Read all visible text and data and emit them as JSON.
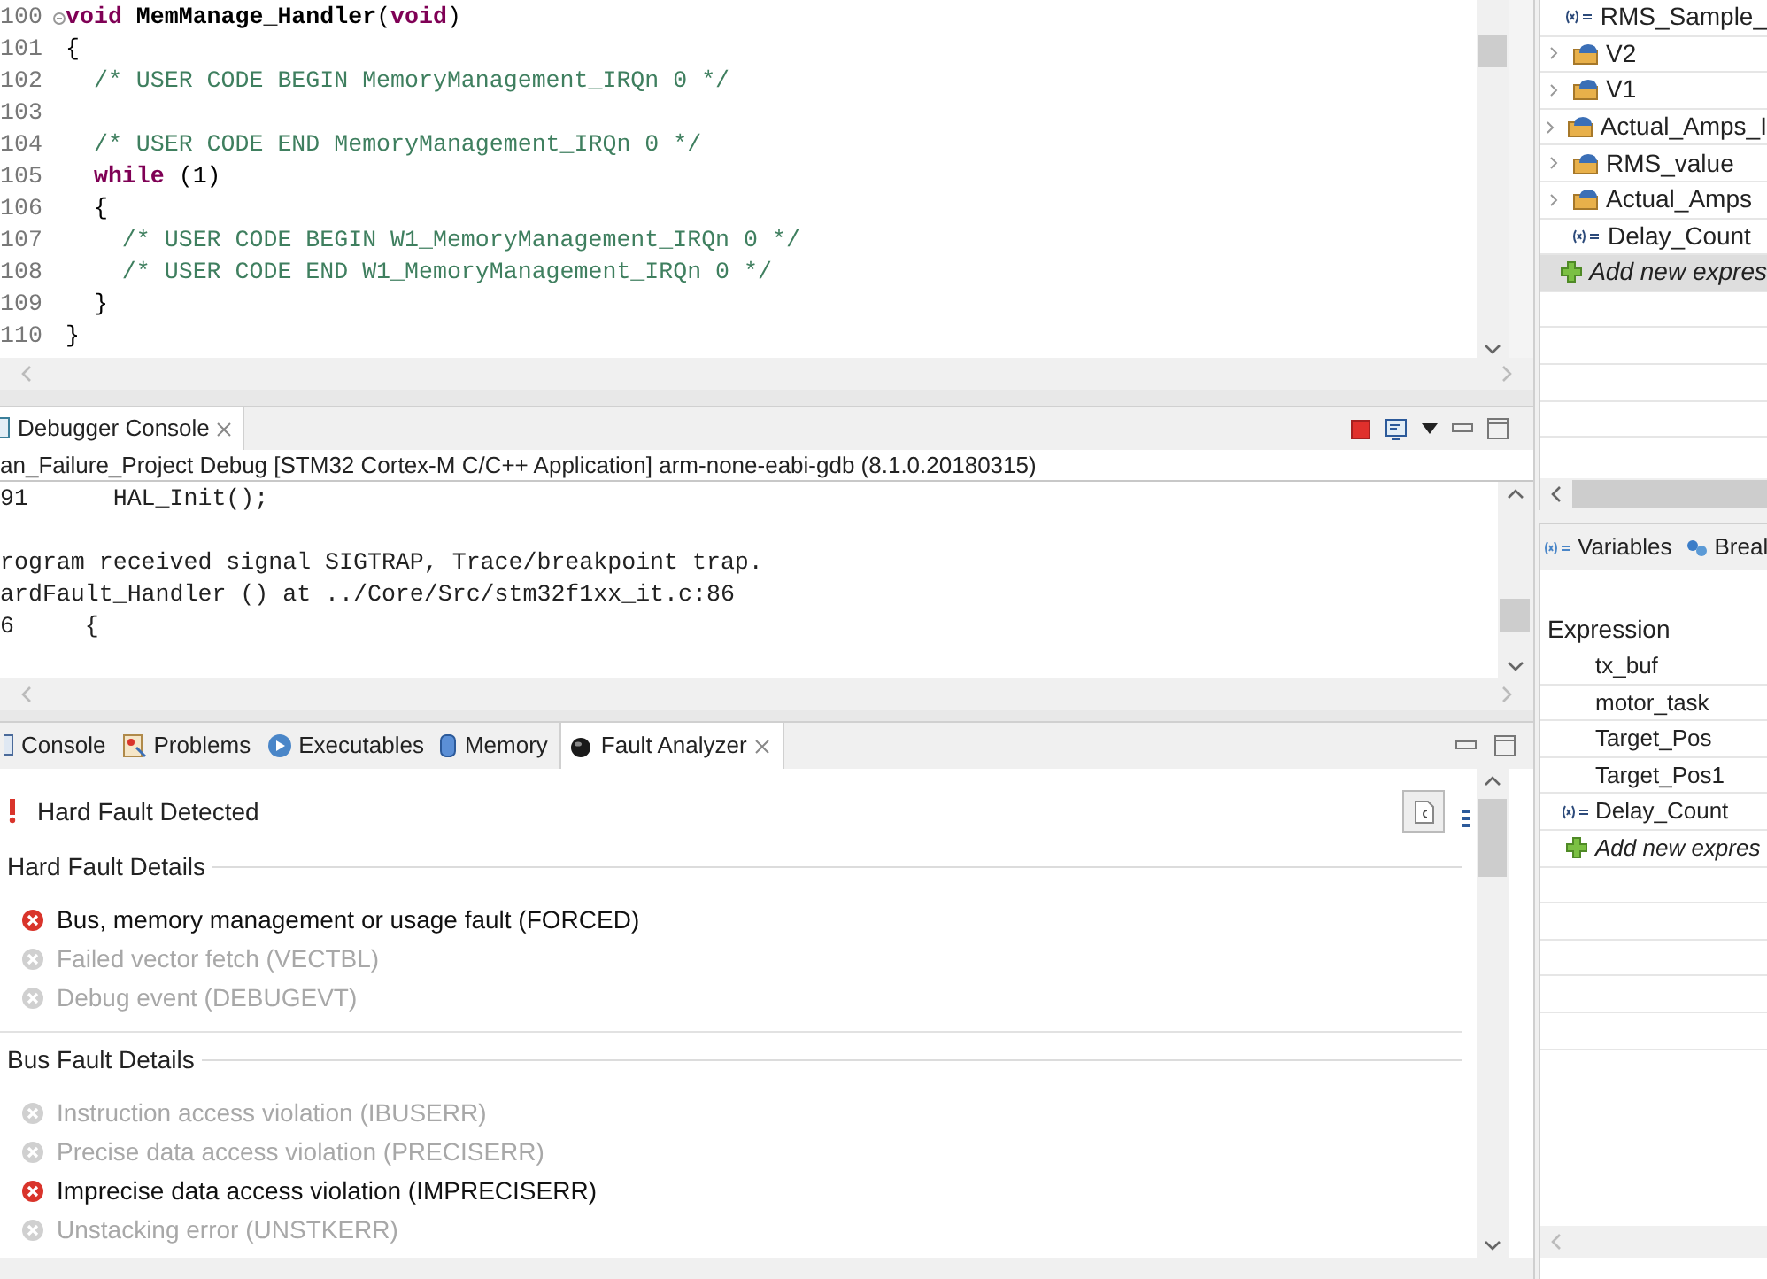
{
  "editor": {
    "lines": [
      {
        "number": "100",
        "foldable": true,
        "segments": [
          {
            "kind": "keyword",
            "text": "void"
          },
          {
            "kind": "name",
            "text": " MemManage_Handler"
          },
          {
            "kind": "plain",
            "text": "("
          },
          {
            "kind": "keyword",
            "text": "void"
          },
          {
            "kind": "plain",
            "text": ")"
          }
        ]
      },
      {
        "number": "101",
        "foldable": false,
        "segments": [
          {
            "kind": "plain",
            "text": "{"
          }
        ]
      },
      {
        "number": "102",
        "foldable": false,
        "segments": [
          {
            "kind": "comment",
            "text": "  /* USER CODE BEGIN MemoryManagement_IRQn 0 */"
          }
        ]
      },
      {
        "number": "103",
        "foldable": false
      },
      {
        "number": "104",
        "foldable": false,
        "segments": [
          {
            "kind": "comment",
            "text": "  /* USER CODE END MemoryManagement_IRQn 0 */"
          }
        ]
      },
      {
        "number": "105",
        "foldable": false,
        "segments": [
          {
            "kind": "keyword",
            "text": "  while"
          },
          {
            "kind": "plain",
            "text": " (1)"
          }
        ]
      },
      {
        "number": "106",
        "foldable": false,
        "segments": [
          {
            "kind": "plain",
            "text": "  {"
          }
        ]
      },
      {
        "number": "107",
        "foldable": false,
        "segments": [
          {
            "kind": "comment",
            "text": "    /* USER CODE BEGIN W1_MemoryManagement_IRQn 0 */"
          }
        ]
      },
      {
        "number": "108",
        "foldable": false,
        "segments": [
          {
            "kind": "comment",
            "text": "    /* USER CODE END W1_MemoryManagement_IRQn 0 */"
          }
        ]
      },
      {
        "number": "109",
        "foldable": false,
        "segments": [
          {
            "kind": "plain",
            "text": "  }"
          }
        ]
      },
      {
        "number": "110",
        "foldable": false,
        "segments": [
          {
            "kind": "plain",
            "text": "}"
          }
        ]
      }
    ]
  },
  "console": {
    "tab": "Debugger Console",
    "launch": "an_Failure_Project Debug [STM32 Cortex-M C/C++ Application] arm-none-eabi-gdb (8.1.0.20180315)",
    "output": "91      HAL_Init();\n\nrogram received signal SIGTRAP, Trace/breakpoint trap.\nardFault_Handler () at ../Core/Src/stm32f1xx_it.c:86\n6     {"
  },
  "bottom_panel": {
    "tabs": [
      {
        "label": "Console",
        "kind": "console",
        "selected": false
      },
      {
        "label": "Problems",
        "kind": "problems",
        "selected": false
      },
      {
        "label": "Executables",
        "kind": "executables",
        "selected": false
      },
      {
        "label": "Memory",
        "kind": "memory",
        "selected": false
      },
      {
        "label": "Fault Analyzer",
        "kind": "fault",
        "selected": true
      }
    ],
    "status": "Hard Fault Detected",
    "groups": [
      {
        "title": "Hard Fault Details",
        "items": [
          {
            "label": "Bus, memory management or usage fault (FORCED)",
            "active": true
          },
          {
            "label": "Failed vector fetch (VECTBL)",
            "active": false
          },
          {
            "label": "Debug event (DEBUGEVT)",
            "active": false
          }
        ]
      },
      {
        "title": "Bus Fault Details",
        "items": [
          {
            "label": "Instruction access violation (IBUSERR)",
            "active": false
          },
          {
            "label": "Precise data access violation (PRECISERR)",
            "active": false
          },
          {
            "label": "Imprecise data access violation (IMPRECISERR)",
            "active": true
          },
          {
            "label": "Unstacking error (UNSTKERR)",
            "active": false
          }
        ]
      }
    ]
  },
  "expressions_top": {
    "rows": [
      {
        "kind": "variable",
        "label": "RMS_Sample_"
      },
      {
        "kind": "struct",
        "label": "V2"
      },
      {
        "kind": "struct",
        "label": "V1"
      },
      {
        "kind": "struct",
        "label": "Actual_Amps_I"
      },
      {
        "kind": "struct",
        "label": "RMS_value"
      },
      {
        "kind": "struct",
        "label": "Actual_Amps"
      },
      {
        "kind": "variable",
        "label": "Delay_Count"
      },
      {
        "kind": "add",
        "label": "Add new expres"
      }
    ]
  },
  "expressions_bottom": {
    "tabs": [
      {
        "label": "Variables",
        "kind": "variables"
      },
      {
        "label": "Breal",
        "kind": "breakpoints"
      }
    ],
    "header": "Expression",
    "rows": [
      {
        "kind": "plain",
        "label": "tx_buf"
      },
      {
        "kind": "plain",
        "label": "motor_task"
      },
      {
        "kind": "plain",
        "label": "Target_Pos"
      },
      {
        "kind": "plain",
        "label": "Target_Pos1"
      },
      {
        "kind": "variable",
        "label": "Delay_Count"
      },
      {
        "kind": "add",
        "label": "Add new expres"
      }
    ]
  }
}
